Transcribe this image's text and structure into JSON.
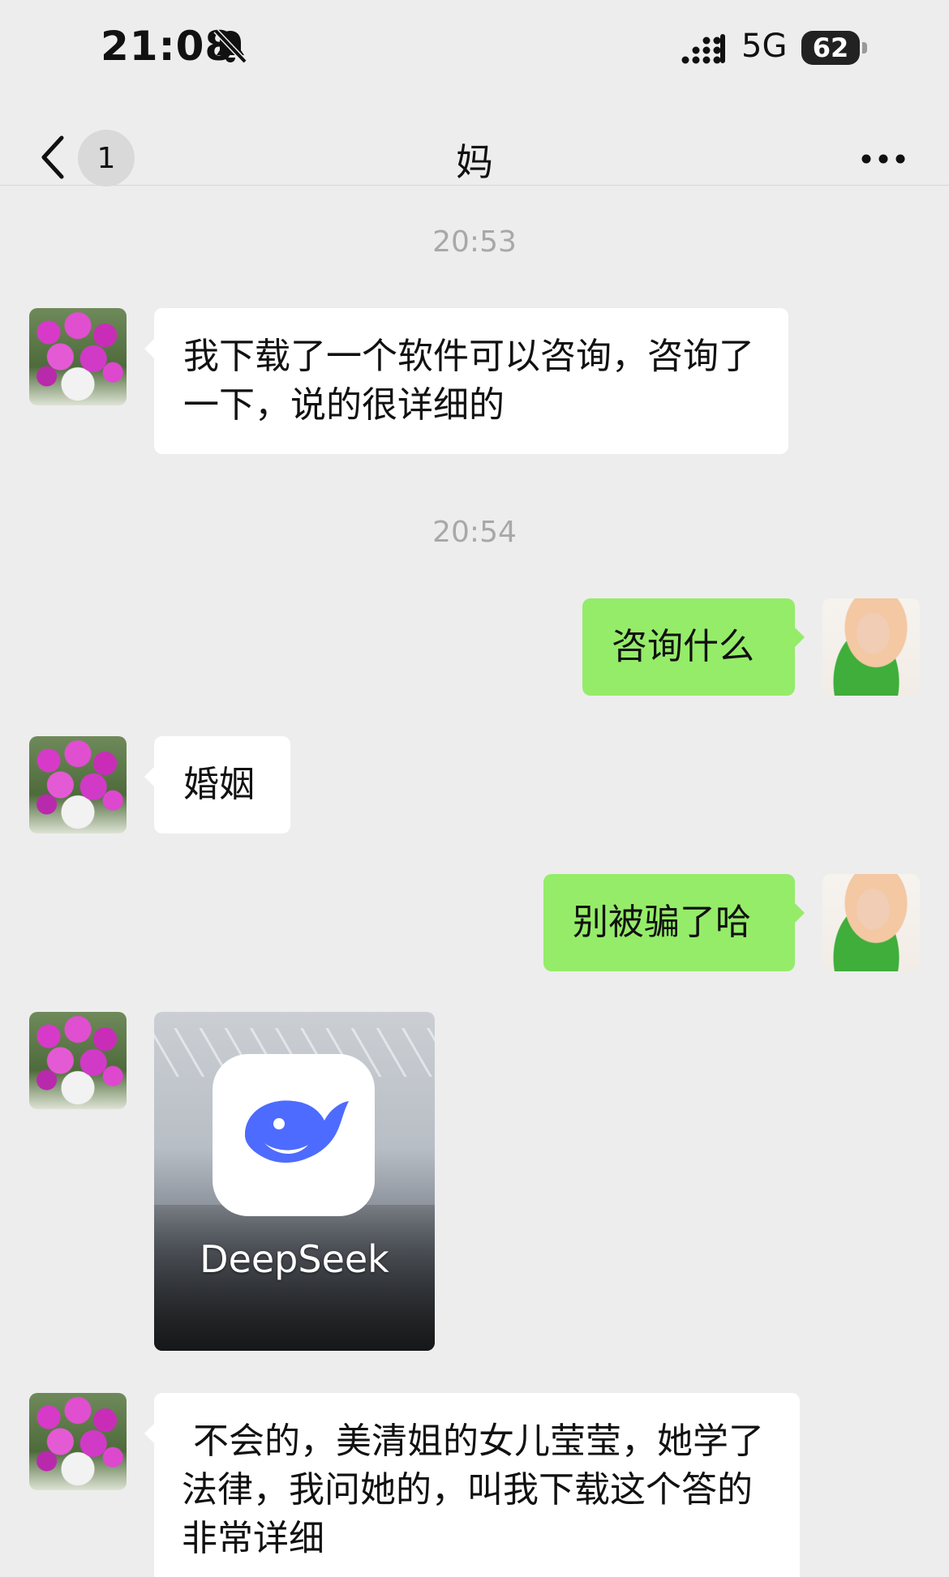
{
  "status_bar": {
    "time": "21:08",
    "network": "5G",
    "battery": "62"
  },
  "nav": {
    "unread_count": "1",
    "title": "妈"
  },
  "messages": [
    {
      "type": "timestamp",
      "text": "20:53"
    },
    {
      "type": "text",
      "side": "left",
      "text": "我下载了一个软件可以咨询，咨询了一下，说的很详细的"
    },
    {
      "type": "timestamp",
      "text": "20:54"
    },
    {
      "type": "text",
      "side": "right",
      "text": "咨询什么"
    },
    {
      "type": "text",
      "side": "left",
      "text": "婚姻"
    },
    {
      "type": "text",
      "side": "right",
      "text": "别被骗了哈"
    },
    {
      "type": "image",
      "side": "left",
      "label": "DeepSeek"
    },
    {
      "type": "text",
      "side": "left",
      "text": " 不会的，美清姐的女儿莹莹，她学了法律，我问她的，叫我下载这个答的非常详细"
    }
  ],
  "colors": {
    "background": "#EDEDED",
    "bubble_left": "#FFFFFF",
    "bubble_right": "#95EC69",
    "deepseek_blue": "#4D6BFE"
  },
  "icons": [
    "bell-slash-icon",
    "signal-icon",
    "back-chevron-icon",
    "more-dots-icon",
    "deepseek-whale-icon"
  ]
}
